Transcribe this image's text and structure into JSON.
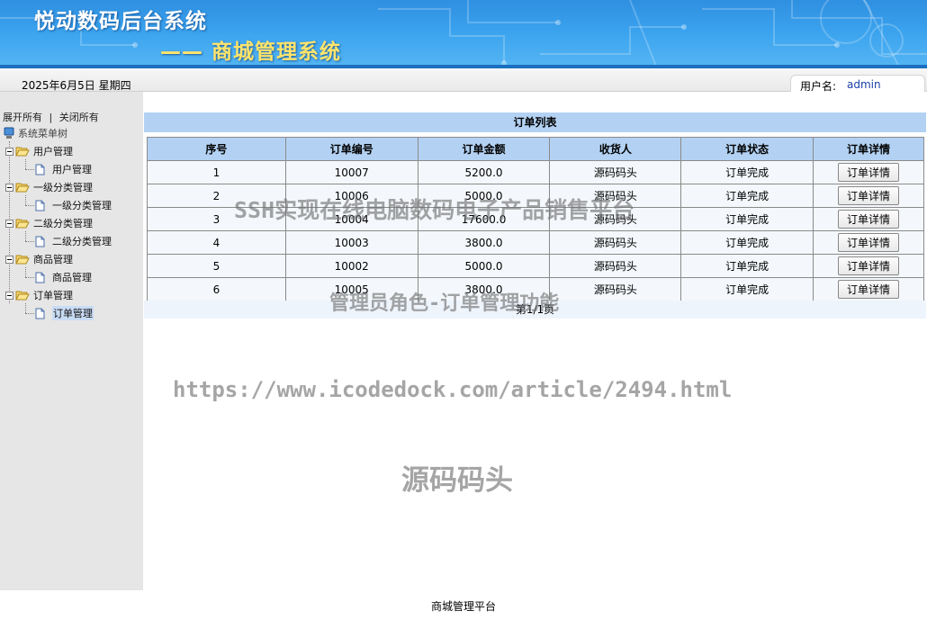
{
  "header": {
    "title": "悦动数码后台系统",
    "subtitle": "—— 商城管理系统"
  },
  "statusbar": {
    "date": "2025年6月5日 星期四",
    "user_label": "用户名:",
    "username": "admin"
  },
  "sidebar": {
    "expand_all": "展开所有",
    "separator": "|",
    "collapse_all": "关闭所有",
    "root_label": "系统菜单树",
    "groups": [
      {
        "label": "用户管理",
        "child": "用户管理"
      },
      {
        "label": "一级分类管理",
        "child": "一级分类管理"
      },
      {
        "label": "二级分类管理",
        "child": "二级分类管理"
      },
      {
        "label": "商品管理",
        "child": "商品管理"
      },
      {
        "label": "订单管理",
        "child": "订单管理"
      }
    ],
    "selected_item": "订单管理"
  },
  "main": {
    "list_title": "订单列表",
    "columns": [
      "序号",
      "订单编号",
      "订单金额",
      "收货人",
      "订单状态",
      "订单详情"
    ],
    "rows": [
      {
        "no": "1",
        "order_id": "10007",
        "amount": "5200.0",
        "receiver": "源码码头",
        "status": "订单完成",
        "action": "订单详情"
      },
      {
        "no": "2",
        "order_id": "10006",
        "amount": "5000.0",
        "receiver": "源码码头",
        "status": "订单完成",
        "action": "订单详情"
      },
      {
        "no": "3",
        "order_id": "10004",
        "amount": "17600.0",
        "receiver": "源码码头",
        "status": "订单完成",
        "action": "订单详情"
      },
      {
        "no": "4",
        "order_id": "10003",
        "amount": "3800.0",
        "receiver": "源码码头",
        "status": "订单完成",
        "action": "订单详情"
      },
      {
        "no": "5",
        "order_id": "10002",
        "amount": "5000.0",
        "receiver": "源码码头",
        "status": "订单完成",
        "action": "订单详情"
      },
      {
        "no": "6",
        "order_id": "10005",
        "amount": "3800.0",
        "receiver": "源码码头",
        "status": "订单完成",
        "action": "订单详情"
      }
    ],
    "pager": "第1/1页"
  },
  "watermarks": {
    "line1": "SSH实现在线电脑数码电子产品销售平台",
    "line2": "管理员角色-订单管理功能",
    "line3": "https://www.icodedock.com/article/2494.html",
    "line4": "源码码头"
  },
  "footer": {
    "text": "商城管理平台"
  },
  "colors": {
    "banner": "#3aa2ee",
    "title_main": "#ffffff",
    "title_sub": "#ffe46b",
    "table_header": "#b3d2f3",
    "sidebar_bg": "#e6e6e6"
  }
}
